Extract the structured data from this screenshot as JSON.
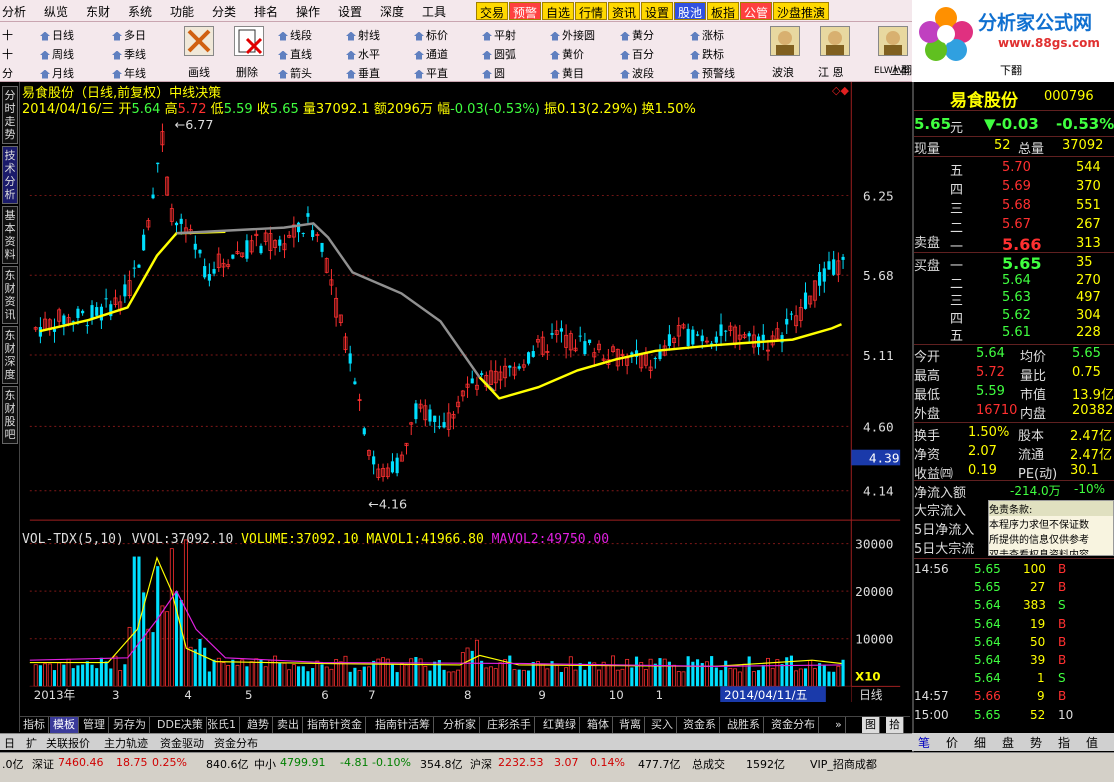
{
  "menu": {
    "items": [
      "分析",
      "纵览",
      "东财",
      "系统",
      "功能",
      "分类",
      "排名",
      "操作",
      "设置",
      "深度",
      "工具"
    ],
    "buttons": [
      "交易",
      "预警",
      "自选",
      "行情",
      "资讯",
      "设置",
      "股池",
      "板指",
      "公管",
      "沙盘推演"
    ]
  },
  "toolbar": {
    "left_letters": [
      "十",
      "十",
      "分"
    ],
    "col1": [
      "日线",
      "周线",
      "月线"
    ],
    "col2": [
      "多日",
      "季线",
      "年线"
    ],
    "draw_label": "画线",
    "delete_label": "删除",
    "col3": [
      "线段",
      "直线",
      "箭头"
    ],
    "col4": [
      "射线",
      "水平",
      "垂直"
    ],
    "col5": [
      "标价",
      "通道",
      "平直"
    ],
    "col6": [
      "平射",
      "圆弧",
      "圆"
    ],
    "col7": [
      "外接圆",
      "黄价",
      "黄目"
    ],
    "col8": [
      "黄分",
      "百分",
      "波段"
    ],
    "col9": [
      "涨标",
      "跌标",
      "预警线"
    ],
    "avatars": [
      "波浪",
      "江 恩",
      "ELWAVE"
    ],
    "page_up": "上翻",
    "page_down": "下翻"
  },
  "logo": {
    "title": "分析家公式网",
    "url": "www.88gs.com"
  },
  "left_nav": [
    "分时走势",
    "技术分析",
    "基本资料",
    "东财资讯",
    "东财深度",
    "东财股吧"
  ],
  "chart": {
    "title": "易食股份（日线,前复权）中线决策",
    "date": "2014/04/16/三",
    "open_label": "开",
    "open": "5.64",
    "high_label": "高",
    "high": "5.72",
    "low_label": "低",
    "low": "5.59",
    "close_label": "收",
    "close": "5.65",
    "vol_label": "量",
    "vol": "37092.1",
    "amount_label": "额",
    "amount": "2096万",
    "change_label": "幅",
    "change": "-0.03(-0.53%)",
    "amp_label": "振",
    "amp": "0.13(2.29%)",
    "turn_label": "换",
    "turn": "1.50%",
    "high_mark": "6.77",
    "low_mark": "4.16",
    "cursor_price": "4.39",
    "price_ticks": [
      "6.25",
      "5.68",
      "5.11",
      "4.60",
      "4.14"
    ],
    "vol_ticks": [
      "30000",
      "20000",
      "10000"
    ],
    "vol_scale": "X10",
    "period_label": "日线",
    "x_labels": [
      "2013年",
      "3",
      "4",
      "5",
      "6",
      "7",
      "8",
      "9",
      "10",
      "1"
    ],
    "date_cursor": "2014/04/11/五"
  },
  "volume": {
    "name": "VOL-TDX(5,10)",
    "vvol_label": "VVOL:",
    "vvol": "37092.10",
    "volume_label": "VOLUME:",
    "volume": "37092.10",
    "mavol1_label": "MAVOL1:",
    "mavol1": "41966.80",
    "mavol2_label": "MAVOL2:",
    "mavol2": "49750.00"
  },
  "bottom_tabs": [
    "指标",
    "模板",
    "管理",
    "另存为",
    "DDE决策",
    "张氏1",
    "趋势",
    "卖出",
    "指南针资金",
    "指南针活筹",
    "分析家",
    "庄彩杀手",
    "红黄绿",
    "箱体",
    "背离",
    "买入",
    "资金系",
    "战胜系",
    "资金分布"
  ],
  "row2": [
    "日",
    "扩",
    "关联报价",
    "主力轨迹",
    "资金驱动",
    "资金分布"
  ],
  "status": {
    "lead": ".0亿",
    "sz_label": "深证",
    "sz": "7460.46",
    "sz_chg": "18.75",
    "sz_pct": "0.25%",
    "sz_amt": "840.6亿",
    "zx_label": "中小",
    "zx": "4799.91",
    "zx_chg": "-4.81",
    "zx_pct": "-0.10%",
    "zx_amt": "354.8亿",
    "hs_label": "沪深",
    "hs": "2232.53",
    "hs_chg": "3.07",
    "hs_pct": "0.14%",
    "hs_amt": "477.7亿",
    "total_label": "总成交",
    "total": "1592亿",
    "vip": "VIP_招商成都"
  },
  "quote": {
    "name": "易食股份",
    "code": "000796",
    "price": "5.65",
    "unit": "元",
    "chg": "▼-0.03",
    "pct": "-0.53%",
    "now_vol_label": "现量",
    "now_vol": "52",
    "total_vol_label": "总量",
    "total_vol": "37092",
    "sell": [
      {
        "lvl": "五",
        "price": "5.70",
        "vol": "544"
      },
      {
        "lvl": "四",
        "price": "5.69",
        "vol": "370"
      },
      {
        "lvl": "三",
        "price": "5.68",
        "vol": "551"
      },
      {
        "lvl": "二",
        "price": "5.67",
        "vol": "267"
      },
      {
        "lvl": "一",
        "price": "5.66",
        "vol": "313"
      }
    ],
    "sell_label": "卖盘",
    "buy_label": "买盘",
    "buy": [
      {
        "lvl": "一",
        "price": "5.65",
        "vol": "35"
      },
      {
        "lvl": "二",
        "price": "5.64",
        "vol": "270"
      },
      {
        "lvl": "三",
        "price": "5.63",
        "vol": "497"
      },
      {
        "lvl": "四",
        "price": "5.62",
        "vol": "304"
      },
      {
        "lvl": "五",
        "price": "5.61",
        "vol": "228"
      }
    ],
    "stats": [
      {
        "l1": "今开",
        "v1": "5.64",
        "l2": "均价",
        "v2": "5.65"
      },
      {
        "l1": "最高",
        "v1": "5.72",
        "l2": "量比",
        "v2": "0.75"
      },
      {
        "l1": "最低",
        "v1": "5.59",
        "l2": "市值",
        "v2": "13.9亿"
      },
      {
        "l1": "外盘",
        "v1": "16710",
        "l2": "内盘",
        "v2": "20382"
      }
    ],
    "stats2": [
      {
        "l1": "换手",
        "v1": "1.50%",
        "l2": "股本",
        "v2": "2.47亿"
      },
      {
        "l1": "净资",
        "v1": "2.07",
        "l2": "流通",
        "v2": "2.47亿"
      },
      {
        "l1": "收益㈣",
        "v1": "0.19",
        "l2": "PE(动)",
        "v2": "30.1"
      }
    ],
    "netflow_label": "净流入额",
    "netflow": "-214.0万",
    "netflow_pct": "-10%",
    "flows": [
      "大宗流入",
      "5日净流入",
      "5日大宗流"
    ],
    "disclaimer_title": "免责条款:",
    "disclaimer": [
      "本程序力求但不保证数",
      "所提供的信息仅供参考",
      "双击查看权息资料内容"
    ],
    "ticks": [
      {
        "t": "14:56",
        "p": "5.65",
        "v": "100",
        "d": "B"
      },
      {
        "t": "",
        "p": "5.65",
        "v": "27",
        "d": "B"
      },
      {
        "t": "",
        "p": "5.64",
        "v": "383",
        "d": "S"
      },
      {
        "t": "",
        "p": "5.64",
        "v": "19",
        "d": "B"
      },
      {
        "t": "",
        "p": "5.64",
        "v": "50",
        "d": "B"
      },
      {
        "t": "",
        "p": "5.64",
        "v": "39",
        "d": "B"
      },
      {
        "t": "",
        "p": "5.64",
        "v": "1",
        "d": "S"
      },
      {
        "t": "14:57",
        "p": "5.66",
        "v": "9",
        "d": "B"
      },
      {
        "t": "15:00",
        "p": "5.65",
        "v": "52",
        "d": "10"
      }
    ],
    "tabs": [
      "笔",
      "价",
      "细",
      "盘",
      "势",
      "指",
      "值"
    ]
  },
  "colors": {
    "up": "#ff3030",
    "down": "#00e0ff",
    "ma_yellow": "#ffff00",
    "ma_gray": "#909090",
    "mavol1": "#ffff00",
    "mavol2": "#e020e0"
  }
}
